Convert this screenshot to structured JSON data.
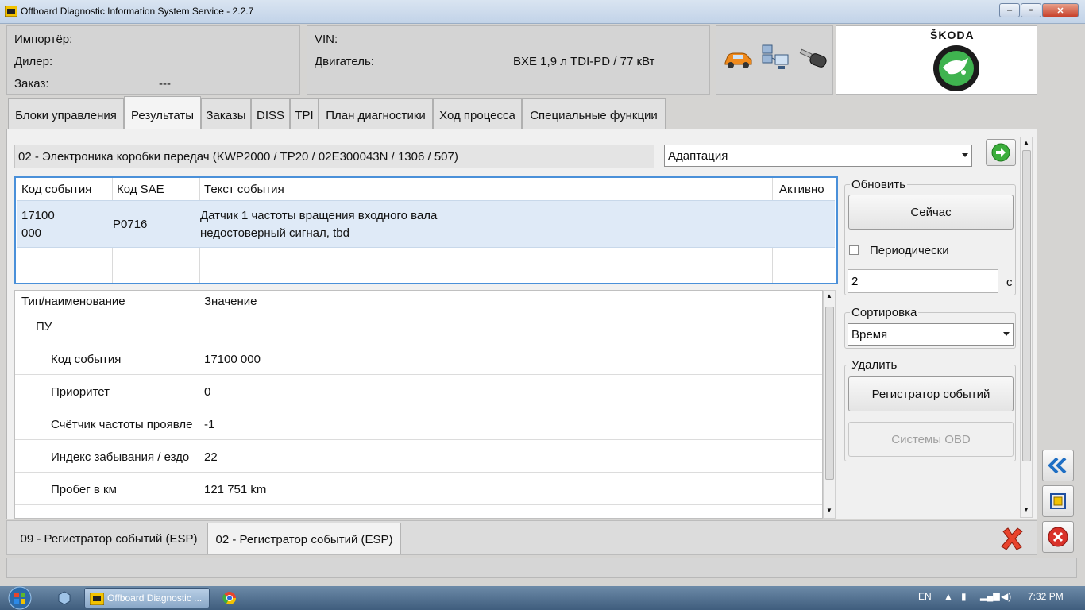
{
  "window": {
    "title": "Offboard Diagnostic Information System Service - 2.2.7"
  },
  "header": {
    "importer_label": "Импортёр:",
    "dealer_label": "Дилер:",
    "order_label": "Заказ:",
    "order_value": "---",
    "vin_label": "VIN:",
    "engine_label": "Двигатель:",
    "engine_value": "BXE 1,9 л TDI-PD / 77 кВт",
    "brand": "ŠKODA"
  },
  "tabs": [
    "Блоки управления",
    "Результаты",
    "Заказы",
    "DISS",
    "TPI",
    "План диагностики",
    "Ход процесса",
    "Специальные функции"
  ],
  "ecu": {
    "title": "02 - Электроника коробки передач  (KWP2000 / TP20 / 02E300043N   / 1306 / 507)"
  },
  "function_select": {
    "value": "Адаптация"
  },
  "events": {
    "headers": [
      "Код события",
      "Код SAE",
      "Текст события",
      "Активно"
    ],
    "row": {
      "code_line1": "17100",
      "code_line2": "000",
      "sae": "P0716",
      "text_line1": "Датчик 1 частоты вращения входного вала",
      "text_line2": "недостоверный сигнал, tbd",
      "active": ""
    }
  },
  "details": {
    "headers": [
      "Тип/наименование",
      "Значение"
    ],
    "rows": [
      {
        "name": "ПУ",
        "value": ""
      },
      {
        "name": "Код события",
        "value": "17100 000"
      },
      {
        "name": "Приоритет",
        "value": "0"
      },
      {
        "name": "Счётчик частоты проявле",
        "value": "-1"
      },
      {
        "name": "Индекс забывания / ездо",
        "value": "22"
      },
      {
        "name": "Пробег в км",
        "value": "121 751 km"
      }
    ]
  },
  "refresh": {
    "title": "Обновить",
    "now_label": "Сейчас",
    "periodic_label": "Периодически",
    "interval_value": "2",
    "unit": "с"
  },
  "sort": {
    "title": "Сортировка",
    "value": "Время"
  },
  "delete": {
    "title": "Удалить",
    "event_recorder_label": "Регистратор событий",
    "obd_label": "Системы OBD"
  },
  "bottom_tabs": [
    "09 - Регистратор событий (ESP)",
    "02 - Регистратор событий (ESP)"
  ],
  "taskbar": {
    "app_label": "Offboard Diagnostic ...",
    "lang": "EN",
    "time": "7:32 PM"
  }
}
